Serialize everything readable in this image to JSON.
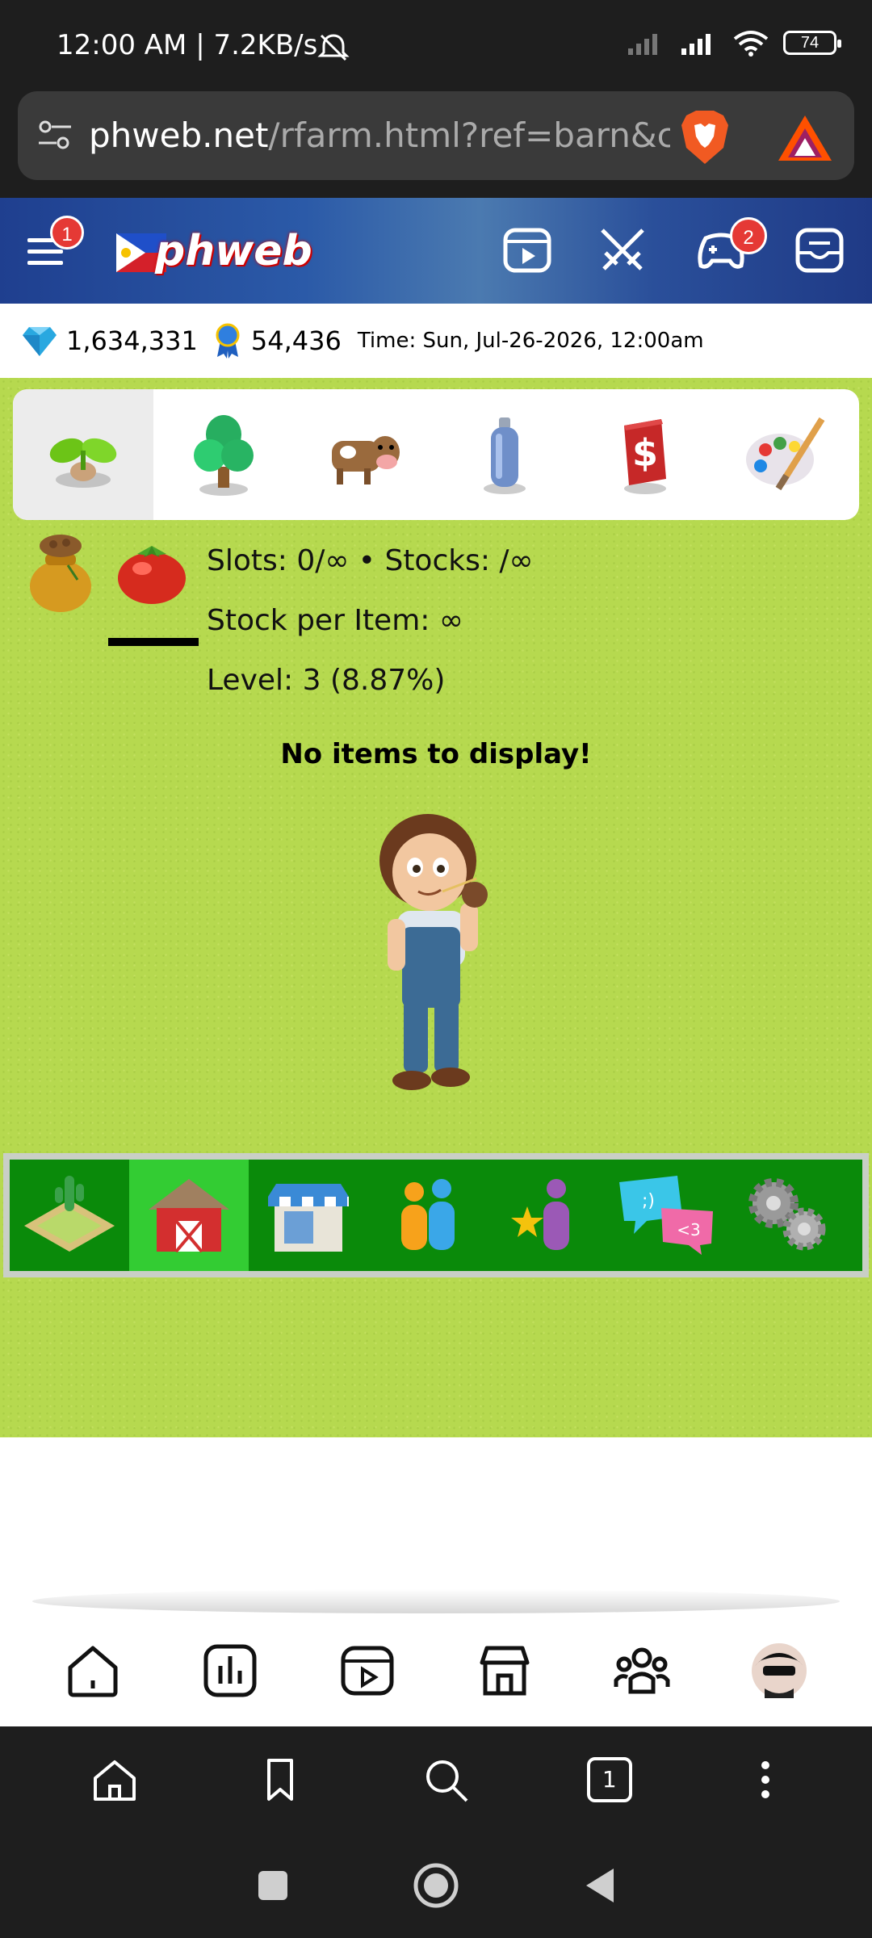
{
  "status": {
    "time_speed": "12:00 AM | 7.2KB/s",
    "battery": "74"
  },
  "browser": {
    "url_domain": "phweb.net",
    "url_path": "/rfarm.html?ref=barn&cat"
  },
  "header": {
    "menu_badge": "1",
    "logo_text": "phweb",
    "games_badge": "2"
  },
  "stats": {
    "diamonds": "1,634,331",
    "ribbons": "54,436",
    "time": "Time: Sun, Jul-26-2026, 12:00am"
  },
  "category_tabs": [
    {
      "name": "seeds-tab",
      "icon": "sprout-icon"
    },
    {
      "name": "trees-tab",
      "icon": "tree-icon"
    },
    {
      "name": "animals-tab",
      "icon": "cow-icon"
    },
    {
      "name": "products-tab",
      "icon": "bottle-icon"
    },
    {
      "name": "money-tab",
      "icon": "dollar-icon"
    },
    {
      "name": "decor-tab",
      "icon": "palette-icon"
    }
  ],
  "barn": {
    "slots_line": "Slots: 0/∞ • Stocks: /∞",
    "stock_per_item": "Stock per Item: ∞",
    "level": "Level: 3 (8.87%)",
    "empty_message": "No items to display!"
  },
  "farm_nav": [
    {
      "name": "farm-nav-field",
      "icon": "field-icon"
    },
    {
      "name": "farm-nav-barn",
      "icon": "barn-icon",
      "active": true
    },
    {
      "name": "farm-nav-shop",
      "icon": "shop-icon"
    },
    {
      "name": "farm-nav-neighbors",
      "icon": "neighbors-icon"
    },
    {
      "name": "farm-nav-rankings",
      "icon": "star-user-icon"
    },
    {
      "name": "farm-nav-chat",
      "icon": "chat-icon"
    },
    {
      "name": "farm-nav-settings",
      "icon": "gears-icon"
    }
  ],
  "browser_nav": {
    "tab_count": "1"
  },
  "colors": {
    "grass": "#b6d94f",
    "nav_green": "#0a8a0a",
    "nav_active": "#33cc33",
    "badge_red": "#e53935"
  }
}
